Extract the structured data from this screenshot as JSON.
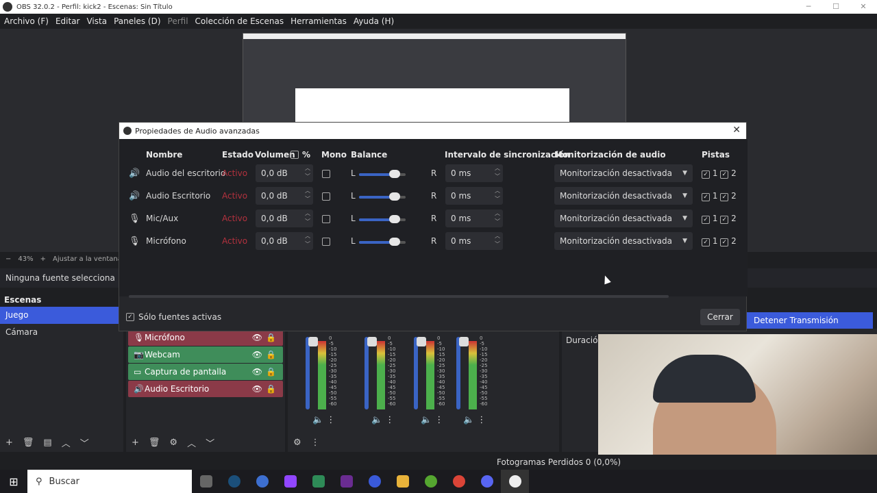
{
  "window": {
    "title": "OBS 32.0.2 - Perfil: kick2 - Escenas: Sin Título"
  },
  "menu": [
    "Archivo (F)",
    "Editar",
    "Vista",
    "Paneles (D)",
    "Perfil",
    "Colección de Escenas",
    "Herramientas",
    "Ayuda (H)"
  ],
  "zoom": {
    "minus": "−",
    "value": "43%",
    "plus": "+",
    "fit": "Ajustar a la ventana"
  },
  "no_source": "Ninguna fuente selecciona",
  "scenes": {
    "title": "Escenas",
    "items": [
      "Juego",
      "Cámara"
    ]
  },
  "sources": {
    "items": [
      {
        "label": "Micrófono",
        "color": "#8b3a48",
        "icon": "mic-icon"
      },
      {
        "label": "Webcam",
        "color": "#3f8d5a",
        "icon": "camera-icon"
      },
      {
        "label": "Captura de pantalla",
        "color": "#3f8d5a",
        "icon": "monitor-icon"
      },
      {
        "label": "Audio Escritorio",
        "color": "#8b3a48",
        "icon": "speaker-icon"
      }
    ]
  },
  "mixer": {
    "ticks": [
      "0",
      "-5",
      "-10",
      "-15",
      "-20",
      "-25",
      "-30",
      "-35",
      "-40",
      "-45",
      "-50",
      "-55",
      "-60"
    ]
  },
  "duration_label": "Duración",
  "stop_button": "Detener Transmisión",
  "status": {
    "dropped_frames": "Fotogramas Perdidos 0 (0,0%)"
  },
  "taskbar": {
    "search_placeholder": "Buscar"
  },
  "dialog": {
    "title": "Propiedades de Audio avanzadas",
    "headers": {
      "name": "Nombre",
      "state": "Estado",
      "volume": "Volumen",
      "percent": "%",
      "mono": "Mono",
      "balance": "Balance",
      "sync": "Intervalo de sincronización",
      "monitoring": "Monitorización de audio",
      "tracks": "Pistas"
    },
    "balance_left": "L",
    "balance_right": "R",
    "rows": [
      {
        "name": "Audio del escritorio",
        "state": "Activo",
        "volume": "0,0 dB",
        "sync": "0 ms",
        "monitoring": "Monitorización desactivada",
        "track1": "1",
        "track2": "2",
        "icon": "speaker-icon"
      },
      {
        "name": "Audio Escritorio",
        "state": "Activo",
        "volume": "0,0 dB",
        "sync": "0 ms",
        "monitoring": "Monitorización desactivada",
        "track1": "1",
        "track2": "2",
        "icon": "speaker-icon"
      },
      {
        "name": "Mic/Aux",
        "state": "Activo",
        "volume": "0,0 dB",
        "sync": "0 ms",
        "monitoring": "Monitorización desactivada",
        "track1": "1",
        "track2": "2",
        "icon": "mic-icon"
      },
      {
        "name": "Micrófono",
        "state": "Activo",
        "volume": "0,0 dB",
        "sync": "0 ms",
        "monitoring": "Monitorización desactivada",
        "track1": "1",
        "track2": "2",
        "icon": "mic-icon"
      }
    ],
    "active_only": "Sólo fuentes activas",
    "close_button": "Cerrar"
  }
}
